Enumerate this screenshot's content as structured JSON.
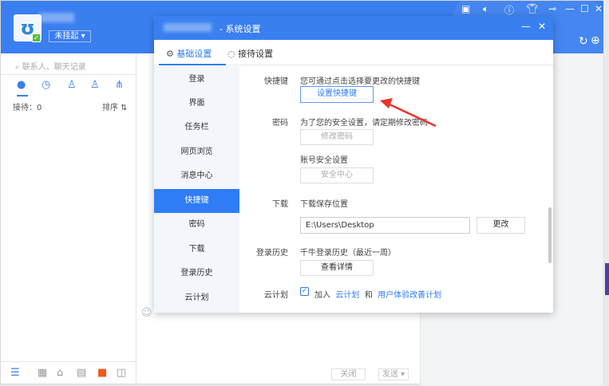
{
  "main": {
    "status": "未挂起",
    "search_placeholder": "联系人、聊天记录",
    "wait_label": "接待：0",
    "sort_label": "排序 ⇅",
    "close_btn": "关闭",
    "send_btn": "发送 ▾"
  },
  "dialog": {
    "title": "- 系统设置",
    "tabs": [
      "基础设置",
      "接待设置"
    ],
    "nav": [
      "登录",
      "界面",
      "任务栏",
      "网页浏览",
      "消息中心",
      "快捷键",
      "密码",
      "下载",
      "登录历史",
      "云计划"
    ],
    "shortcut": {
      "label": "快捷键",
      "desc": "您可通过点击选择要更改的快捷键",
      "button": "设置快捷键"
    },
    "password": {
      "label": "密码",
      "desc": "为了您的安全设置，请定期修改密码",
      "button": "修改密码",
      "security_desc": "账号安全设置",
      "security_button": "安全中心"
    },
    "download": {
      "label": "下载",
      "desc": "下载保存位置",
      "path": "E:\\Users\\Desktop",
      "change_button": "更改"
    },
    "history": {
      "label": "登录历史",
      "desc": "千牛登录历史（最近一周）",
      "button": "查看详情"
    },
    "cloud": {
      "label": "云计划",
      "join": "加入",
      "link1": "云计划",
      "and": "和",
      "link2": "用户体验改善计划",
      "checked": true
    }
  },
  "colors": {
    "accent": "#3a7ff0",
    "active_nav": "#2e7cf6",
    "arrow": "#e8322b"
  }
}
